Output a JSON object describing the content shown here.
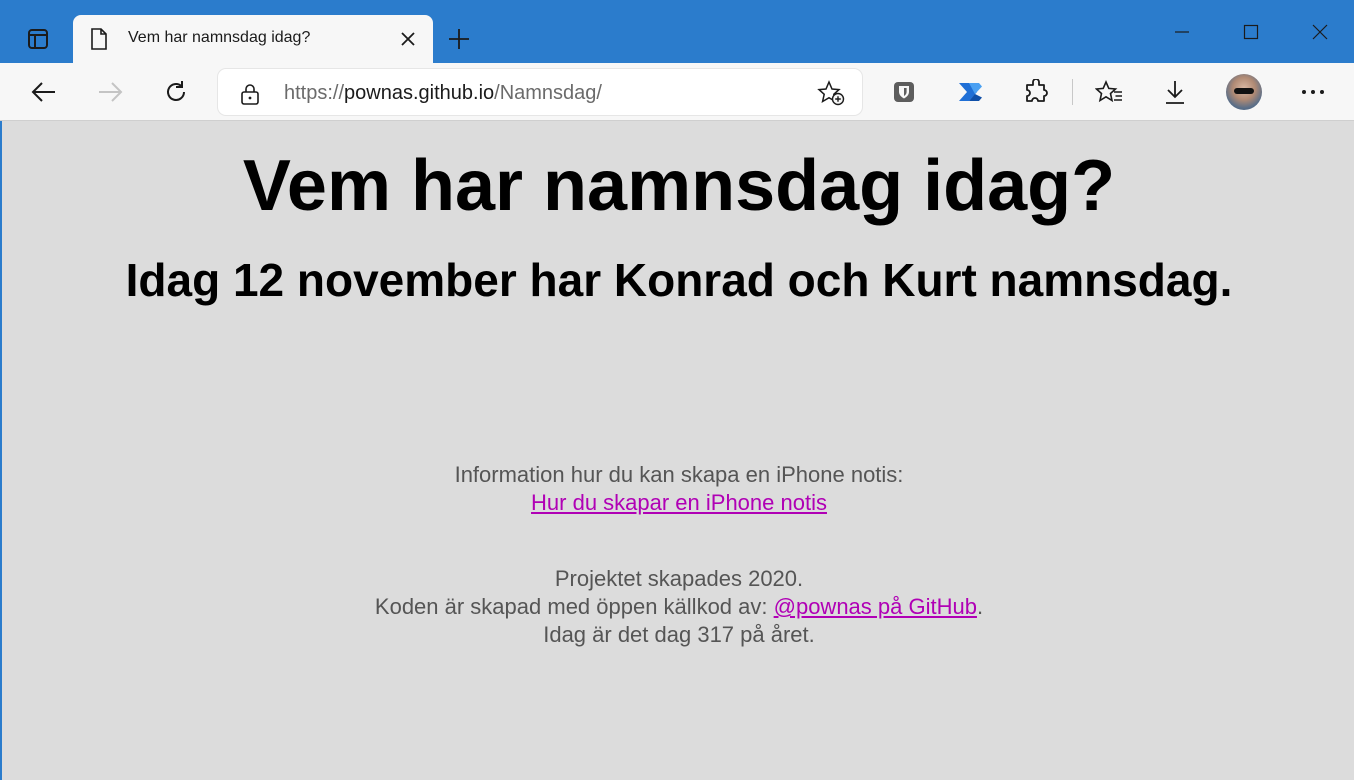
{
  "browser": {
    "tab": {
      "title": "Vem har namnsdag idag?"
    },
    "address": {
      "scheme": "https://",
      "host": "pownas.github.io",
      "path": "/Namnsdag/"
    }
  },
  "page": {
    "heading": "Vem har namnsdag idag?",
    "subheading": "Idag 12 november har Konrad och Kurt namnsdag.",
    "info_text": "Information hur du kan skapa en iPhone notis:",
    "info_link": "Hur du skapar en iPhone notis",
    "project_created": "Projektet skapades 2020.",
    "code_prefix": "Koden är skapad med öppen källkod av: ",
    "code_link": "@pownas på GitHub",
    "code_suffix": ".",
    "day_of_year": "Idag är det dag 317 på året."
  },
  "colors": {
    "titlebar": "#2b7ccc",
    "toolbar": "#f7f7f7",
    "page_bg": "#dcdcdc",
    "link": "#b000b5",
    "muted_text": "#555555"
  },
  "icons": [
    "tab-actions-icon",
    "page-icon",
    "close-icon",
    "plus-icon",
    "minimize-icon",
    "maximize-icon",
    "window-close-icon",
    "back-arrow-icon",
    "forward-arrow-icon",
    "refresh-icon",
    "lock-icon",
    "add-favorite-icon",
    "bitwarden-icon",
    "power-automate-icon",
    "extensions-icon",
    "favorites-icon",
    "download-icon",
    "more-icon"
  ]
}
